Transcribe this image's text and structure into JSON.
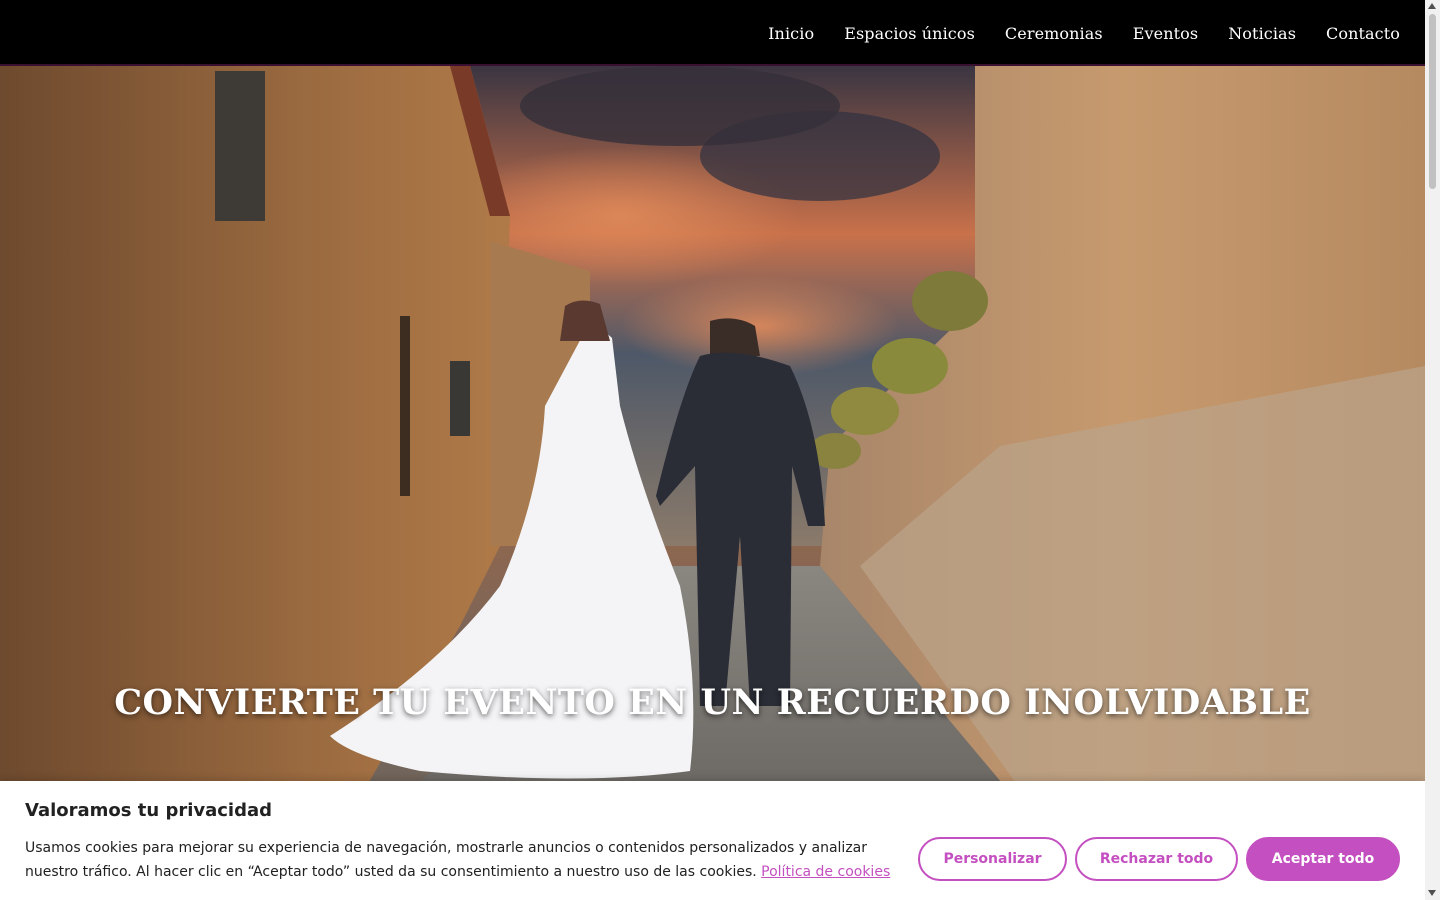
{
  "nav": {
    "items": [
      {
        "label": "Inicio"
      },
      {
        "label": "Espacios únicos"
      },
      {
        "label": "Ceremonias"
      },
      {
        "label": "Eventos"
      },
      {
        "label": "Noticias"
      },
      {
        "label": "Contacto"
      }
    ]
  },
  "hero": {
    "title": "CONVIERTE TU EVENTO EN UN RECUERDO INOLVIDABLE"
  },
  "cookie_banner": {
    "title": "Valoramos tu privacidad",
    "text": "Usamos cookies para mejorar su experiencia de navegación, mostrarle anuncios o contenidos personalizados y analizar nuestro tráfico. Al hacer clic en “Aceptar todo” usted da su consentimiento a nuestro uso de las cookies.",
    "policy_link": "Política de cookies",
    "buttons": {
      "customize": "Personalizar",
      "reject": "Rechazar todo",
      "accept": "Aceptar todo"
    }
  },
  "colors": {
    "accent": "#c44fc0",
    "header_bg": "#000000"
  }
}
